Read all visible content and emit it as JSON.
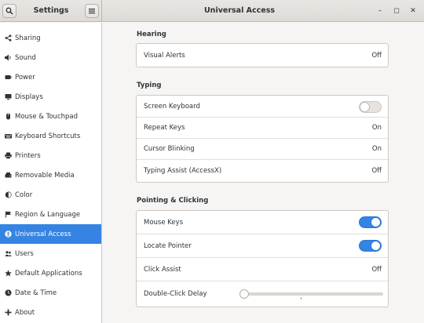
{
  "header": {
    "left_title": "Settings",
    "title": "Universal Access",
    "controls": {
      "minimize": "–",
      "maximize": "◻",
      "close": "✕"
    }
  },
  "icons": {
    "search": "search-icon",
    "menu": "hamburger-menu-icon"
  },
  "sidebar": {
    "items": [
      {
        "label": "Sharing",
        "icon": "share-icon",
        "active": false
      },
      {
        "label": "Sound",
        "icon": "speaker-icon",
        "active": false
      },
      {
        "label": "Power",
        "icon": "power-icon",
        "active": false
      },
      {
        "label": "Displays",
        "icon": "display-icon",
        "active": false
      },
      {
        "label": "Mouse & Touchpad",
        "icon": "mouse-icon",
        "active": false
      },
      {
        "label": "Keyboard Shortcuts",
        "icon": "keyboard-icon",
        "active": false
      },
      {
        "label": "Printers",
        "icon": "printer-icon",
        "active": false
      },
      {
        "label": "Removable Media",
        "icon": "media-icon",
        "active": false
      },
      {
        "label": "Color",
        "icon": "color-icon",
        "active": false
      },
      {
        "label": "Region & Language",
        "icon": "flag-icon",
        "active": false
      },
      {
        "label": "Universal Access",
        "icon": "accessibility-icon",
        "active": true
      },
      {
        "label": "Users",
        "icon": "users-icon",
        "active": false
      },
      {
        "label": "Default Applications",
        "icon": "star-icon",
        "active": false
      },
      {
        "label": "Date & Time",
        "icon": "clock-icon",
        "active": false
      },
      {
        "label": "About",
        "icon": "plus-icon",
        "active": false
      }
    ]
  },
  "sections": {
    "hearing": {
      "title": "Hearing",
      "rows": [
        {
          "label": "Visual Alerts",
          "value": "Off"
        }
      ]
    },
    "typing": {
      "title": "Typing",
      "rows": [
        {
          "label": "Screen Keyboard",
          "switch": false
        },
        {
          "label": "Repeat Keys",
          "value": "On"
        },
        {
          "label": "Cursor Blinking",
          "value": "On"
        },
        {
          "label": "Typing Assist (AccessX)",
          "value": "Off"
        }
      ]
    },
    "pointing": {
      "title": "Pointing & Clicking",
      "rows": [
        {
          "label": "Mouse Keys",
          "switch": true
        },
        {
          "label": "Locate Pointer",
          "switch": true
        },
        {
          "label": "Click Assist",
          "value": "Off"
        },
        {
          "label": "Double-Click Delay",
          "slider": 0.0
        }
      ]
    }
  },
  "colors": {
    "accent": "#3584e4",
    "sidebar_bg": "#ffffff",
    "window_bg": "#f6f5f4"
  }
}
